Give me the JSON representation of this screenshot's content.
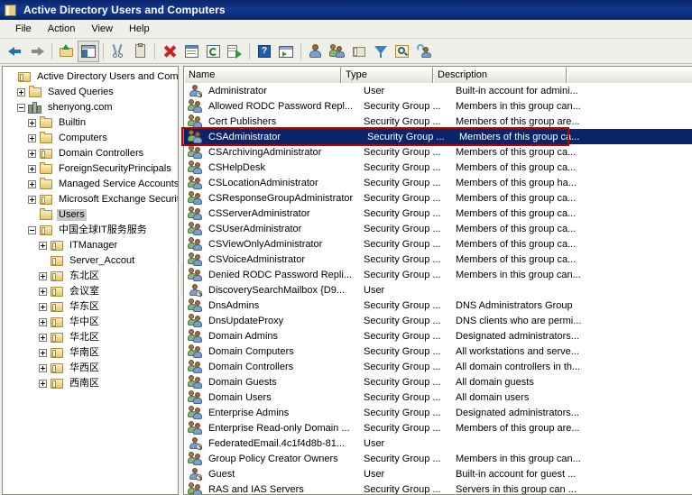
{
  "window": {
    "title": "Active Directory Users and Computers",
    "icon": "mmc-console-icon"
  },
  "menu": {
    "items": [
      {
        "label": "File",
        "name": "menu-file"
      },
      {
        "label": "Action",
        "name": "menu-action"
      },
      {
        "label": "View",
        "name": "menu-view"
      },
      {
        "label": "Help",
        "name": "menu-help"
      }
    ]
  },
  "toolbar": {
    "buttons": [
      {
        "icon": "back-arrow-icon",
        "name": "toolbar-back"
      },
      {
        "icon": "forward-arrow-icon",
        "name": "toolbar-forward"
      },
      {
        "sep": true
      },
      {
        "icon": "up-folder-icon",
        "name": "toolbar-up-one-level"
      },
      {
        "icon": "show-hide-tree-icon",
        "name": "toolbar-show-hide-console-tree",
        "pressed": true
      },
      {
        "sep": true
      },
      {
        "icon": "cut-scissors-icon",
        "name": "toolbar-cut"
      },
      {
        "icon": "clipboard-paste-icon",
        "name": "toolbar-paste"
      },
      {
        "sep": true
      },
      {
        "icon": "delete-x-icon",
        "name": "toolbar-delete"
      },
      {
        "icon": "properties-icon",
        "name": "toolbar-properties"
      },
      {
        "icon": "refresh-icon",
        "name": "toolbar-refresh"
      },
      {
        "icon": "export-list-icon",
        "name": "toolbar-export-list"
      },
      {
        "sep": true
      },
      {
        "icon": "help-question-icon",
        "name": "toolbar-help"
      },
      {
        "icon": "run-console-icon",
        "name": "toolbar-show-snapin"
      },
      {
        "sep": true
      },
      {
        "icon": "new-user-icon",
        "name": "toolbar-new-user"
      },
      {
        "icon": "new-group-icon",
        "name": "toolbar-new-group"
      },
      {
        "icon": "new-container-icon",
        "name": "toolbar-new-container"
      },
      {
        "icon": "filter-funnel-icon",
        "name": "toolbar-filter"
      },
      {
        "icon": "find-magnifier-icon",
        "name": "toolbar-find"
      },
      {
        "icon": "query-users-icon",
        "name": "toolbar-saved-query"
      }
    ]
  },
  "tree": {
    "nodes": [
      {
        "label": "Active Directory Users and Comput",
        "indent": 0,
        "expander": "none",
        "icon": "console-root-icon",
        "selected": false
      },
      {
        "label": "Saved Queries",
        "indent": 1,
        "expander": "plus",
        "icon": "folder-icon",
        "selected": false
      },
      {
        "label": "shenyong.com",
        "indent": 1,
        "expander": "minus",
        "icon": "domain-icon",
        "selected": false
      },
      {
        "label": "Builtin",
        "indent": 2,
        "expander": "plus",
        "icon": "folder-icon",
        "selected": false
      },
      {
        "label": "Computers",
        "indent": 2,
        "expander": "plus",
        "icon": "folder-icon",
        "selected": false
      },
      {
        "label": "Domain Controllers",
        "indent": 2,
        "expander": "plus",
        "icon": "ou-folder-icon",
        "selected": false
      },
      {
        "label": "ForeignSecurityPrincipals",
        "indent": 2,
        "expander": "plus",
        "icon": "folder-icon",
        "selected": false
      },
      {
        "label": "Managed Service Accounts",
        "indent": 2,
        "expander": "plus",
        "icon": "folder-icon",
        "selected": false
      },
      {
        "label": "Microsoft Exchange Securit",
        "indent": 2,
        "expander": "plus",
        "icon": "ou-folder-icon",
        "selected": false
      },
      {
        "label": "Users",
        "indent": 2,
        "expander": "none",
        "icon": "folder-icon",
        "selected": true
      },
      {
        "label": "中国全球IT服务服务",
        "indent": 2,
        "expander": "minus",
        "icon": "ou-folder-icon",
        "selected": false
      },
      {
        "label": "ITManager",
        "indent": 3,
        "expander": "plus",
        "icon": "ou-folder-icon",
        "selected": false
      },
      {
        "label": "Server_Accout",
        "indent": 3,
        "expander": "none",
        "icon": "ou-folder-icon",
        "selected": false
      },
      {
        "label": "东北区",
        "indent": 3,
        "expander": "plus",
        "icon": "ou-folder-icon",
        "selected": false
      },
      {
        "label": "会议室",
        "indent": 3,
        "expander": "plus",
        "icon": "ou-folder-icon",
        "selected": false
      },
      {
        "label": "华东区",
        "indent": 3,
        "expander": "plus",
        "icon": "ou-folder-icon",
        "selected": false
      },
      {
        "label": "华中区",
        "indent": 3,
        "expander": "plus",
        "icon": "ou-folder-icon",
        "selected": false
      },
      {
        "label": "华北区",
        "indent": 3,
        "expander": "plus",
        "icon": "ou-folder-icon",
        "selected": false
      },
      {
        "label": "华南区",
        "indent": 3,
        "expander": "plus",
        "icon": "ou-folder-icon",
        "selected": false
      },
      {
        "label": "华西区",
        "indent": 3,
        "expander": "plus",
        "icon": "ou-folder-icon",
        "selected": false
      },
      {
        "label": "西南区",
        "indent": 3,
        "expander": "plus",
        "icon": "ou-folder-icon",
        "selected": false
      }
    ]
  },
  "list": {
    "columns": [
      {
        "label": "Name",
        "name": "column-header-name"
      },
      {
        "label": "Type",
        "name": "column-header-type"
      },
      {
        "label": "Description",
        "name": "column-header-description"
      },
      {
        "label": "",
        "name": "column-header-filler"
      }
    ],
    "selected_index": 3,
    "annotation_color": "#c00000",
    "rows": [
      {
        "name": "Administrator",
        "type": "User",
        "description": "Built-in account for admini...",
        "icon": "user-icon"
      },
      {
        "name": "Allowed RODC Password Repl...",
        "type": "Security Group ...",
        "description": "Members in this group can...",
        "icon": "group-icon"
      },
      {
        "name": "Cert Publishers",
        "type": "Security Group ...",
        "description": "Members of this group are...",
        "icon": "group-icon"
      },
      {
        "name": "CSAdministrator",
        "type": "Security Group ...",
        "description": "Members of this group ca...",
        "icon": "group-icon"
      },
      {
        "name": "CSArchivingAdministrator",
        "type": "Security Group ...",
        "description": "Members of this group ca...",
        "icon": "group-icon"
      },
      {
        "name": "CSHelpDesk",
        "type": "Security Group ...",
        "description": "Members of this group ca...",
        "icon": "group-icon"
      },
      {
        "name": "CSLocationAdministrator",
        "type": "Security Group ...",
        "description": "Members of this group ha...",
        "icon": "group-icon"
      },
      {
        "name": "CSResponseGroupAdministrator",
        "type": "Security Group ...",
        "description": "Members of this group ca...",
        "icon": "group-icon"
      },
      {
        "name": "CSServerAdministrator",
        "type": "Security Group ...",
        "description": "Members of this group ca...",
        "icon": "group-icon"
      },
      {
        "name": "CSUserAdministrator",
        "type": "Security Group ...",
        "description": "Members of this group ca...",
        "icon": "group-icon"
      },
      {
        "name": "CSViewOnlyAdministrator",
        "type": "Security Group ...",
        "description": "Members of this group ca...",
        "icon": "group-icon"
      },
      {
        "name": "CSVoiceAdministrator",
        "type": "Security Group ...",
        "description": "Members of this group ca...",
        "icon": "group-icon"
      },
      {
        "name": "Denied RODC Password Repli...",
        "type": "Security Group ...",
        "description": "Members in this group can...",
        "icon": "group-icon"
      },
      {
        "name": "DiscoverySearchMailbox {D9...",
        "type": "User",
        "description": "",
        "icon": "user-icon"
      },
      {
        "name": "DnsAdmins",
        "type": "Security Group ...",
        "description": "DNS Administrators Group",
        "icon": "group-icon"
      },
      {
        "name": "DnsUpdateProxy",
        "type": "Security Group ...",
        "description": "DNS clients who are permi...",
        "icon": "group-icon"
      },
      {
        "name": "Domain Admins",
        "type": "Security Group ...",
        "description": "Designated administrators...",
        "icon": "group-icon"
      },
      {
        "name": "Domain Computers",
        "type": "Security Group ...",
        "description": "All workstations and serve...",
        "icon": "group-icon"
      },
      {
        "name": "Domain Controllers",
        "type": "Security Group ...",
        "description": "All domain controllers in th...",
        "icon": "group-icon"
      },
      {
        "name": "Domain Guests",
        "type": "Security Group ...",
        "description": "All domain guests",
        "icon": "group-icon"
      },
      {
        "name": "Domain Users",
        "type": "Security Group ...",
        "description": "All domain users",
        "icon": "group-icon"
      },
      {
        "name": "Enterprise Admins",
        "type": "Security Group ...",
        "description": "Designated administrators...",
        "icon": "group-icon"
      },
      {
        "name": "Enterprise Read-only Domain ...",
        "type": "Security Group ...",
        "description": "Members of this group are...",
        "icon": "group-icon"
      },
      {
        "name": "FederatedEmail.4c1f4d8b-81...",
        "type": "User",
        "description": "",
        "icon": "user-icon"
      },
      {
        "name": "Group Policy Creator Owners",
        "type": "Security Group ...",
        "description": "Members in this group can...",
        "icon": "group-icon"
      },
      {
        "name": "Guest",
        "type": "User",
        "description": "Built-in account for guest ...",
        "icon": "user-icon"
      },
      {
        "name": "RAS and IAS Servers",
        "type": "Security Group ...",
        "description": "Servers in this group can ...",
        "icon": "group-icon"
      }
    ]
  }
}
